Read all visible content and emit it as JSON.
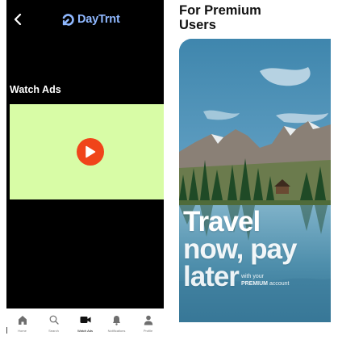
{
  "phone": {
    "brand": {
      "name": "DayTrnt",
      "logo_icon": "daytrnt-logo-icon",
      "color": "#8fb8ff"
    },
    "back_icon": "chevron-left-icon",
    "section_title": "Watch Ads",
    "ad_area": {
      "background": "#d8fca6",
      "play_icon": "play-icon",
      "play_color": "#f0441a"
    },
    "bottom_nav": {
      "items": [
        {
          "label": "Home",
          "icon": "home-icon",
          "active": false
        },
        {
          "label": "Search",
          "icon": "search-icon",
          "active": false
        },
        {
          "label": "Watch Ads",
          "icon": "video-camera-icon",
          "active": true
        },
        {
          "label": "Notifications",
          "icon": "bell-icon",
          "active": false
        },
        {
          "label": "Profile",
          "icon": "user-icon",
          "active": false
        }
      ]
    }
  },
  "premium": {
    "heading_line1": "For Premium",
    "heading_line2": "Users",
    "card": {
      "hero_line1": "Travel",
      "hero_line2": "now, pay",
      "hero_line3": "later",
      "tagline_line1": "with your",
      "tagline_bold": "PREMIUM",
      "tagline_line2_rest": " account"
    }
  }
}
